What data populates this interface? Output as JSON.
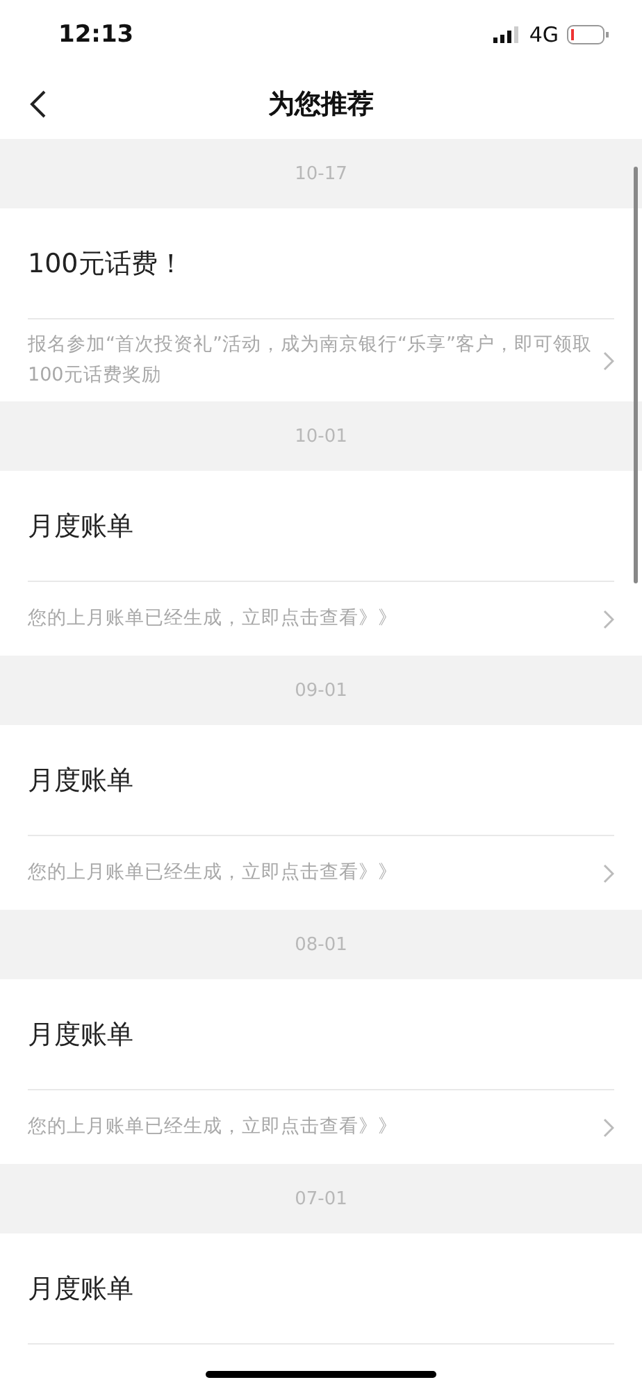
{
  "status_bar": {
    "time": "12:13",
    "network": "4G"
  },
  "nav": {
    "title": "为您推荐"
  },
  "sections": [
    {
      "date": "10-17",
      "title": "100元话费！",
      "description": "报名参加“首次投资礼”活动，成为南京银行“乐享”客户，即可领取100元话费奖励"
    },
    {
      "date": "10-01",
      "title": "月度账单",
      "description": "您的上月账单已经生成，立即点击查看》》"
    },
    {
      "date": "09-01",
      "title": "月度账单",
      "description": "您的上月账单已经生成，立即点击查看》》"
    },
    {
      "date": "08-01",
      "title": "月度账单",
      "description": "您的上月账单已经生成，立即点击查看》》"
    },
    {
      "date": "07-01",
      "title": "月度账单"
    }
  ]
}
